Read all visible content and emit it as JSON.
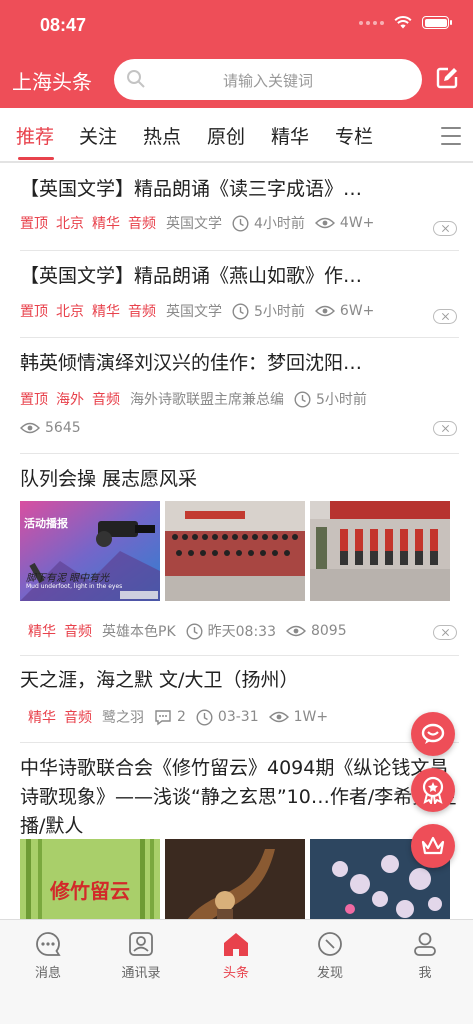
{
  "status_bar": {
    "time": "08:47"
  },
  "header": {
    "title": "上海头条",
    "search_placeholder": "请输入关键词"
  },
  "tabs": [
    "推荐",
    "关注",
    "热点",
    "原创",
    "精华",
    "专栏"
  ],
  "active_tab": "推荐",
  "feed": [
    {
      "title": "【英国文学】精品朗诵《读三字成语》…",
      "tags": [
        "置顶",
        "北京",
        "精华",
        "音频"
      ],
      "source": "英国文学",
      "time": "4小时前",
      "views": "4W+"
    },
    {
      "title": "【英国文学】精品朗诵《燕山如歌》作…",
      "tags": [
        "置顶",
        "北京",
        "精华",
        "音频"
      ],
      "source": "英国文学",
      "time": "5小时前",
      "views": "6W+"
    },
    {
      "title": "韩英倾情演绎刘汉兴的佳作：梦回沈阳…",
      "tags": [
        "置顶",
        "海外",
        "音频"
      ],
      "source": "海外诗歌联盟主席兼总编",
      "time": "5小时前",
      "views": "5645"
    },
    {
      "title": "队列会操 展志愿风采",
      "tags": [
        "精华",
        "音频"
      ],
      "source": "英雄本色PK",
      "time": "昨天08:33",
      "views": "8095",
      "image_texts": [
        "活动播报",
        "脚下有泥 眼中有光",
        "Mud underfoot, light in the eyes"
      ]
    },
    {
      "title": "天之涯，海之默 文/大卫（扬州）",
      "tags": [
        "精华",
        "音频"
      ],
      "source": "鹭之羽",
      "comments": "2",
      "time": "03-31",
      "views": "1W+"
    },
    {
      "title": "中华诗歌联合会《修竹留云》4094期《纵论钱文昌诗歌现象》——浅谈“静之玄思”10…作者/李希勇/主播/默人",
      "image_texts": [
        "修竹留云"
      ]
    }
  ],
  "bottom_nav": [
    "消息",
    "通讯录",
    "头条",
    "发现",
    "我"
  ],
  "active_nav": "头条",
  "colors": {
    "brand": "#ee4e58",
    "accent": "#e8424c"
  }
}
